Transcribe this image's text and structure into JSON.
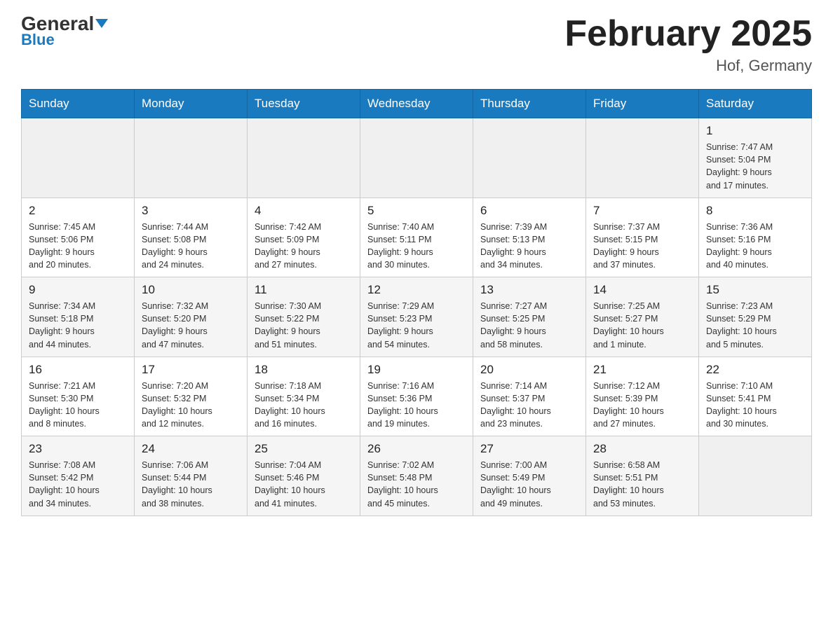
{
  "header": {
    "logo": {
      "general": "General",
      "blue": "Blue"
    },
    "title": "February 2025",
    "location": "Hof, Germany"
  },
  "weekdays": [
    "Sunday",
    "Monday",
    "Tuesday",
    "Wednesday",
    "Thursday",
    "Friday",
    "Saturday"
  ],
  "weeks": [
    {
      "days": [
        {
          "num": "",
          "info": ""
        },
        {
          "num": "",
          "info": ""
        },
        {
          "num": "",
          "info": ""
        },
        {
          "num": "",
          "info": ""
        },
        {
          "num": "",
          "info": ""
        },
        {
          "num": "",
          "info": ""
        },
        {
          "num": "1",
          "info": "Sunrise: 7:47 AM\nSunset: 5:04 PM\nDaylight: 9 hours\nand 17 minutes."
        }
      ]
    },
    {
      "days": [
        {
          "num": "2",
          "info": "Sunrise: 7:45 AM\nSunset: 5:06 PM\nDaylight: 9 hours\nand 20 minutes."
        },
        {
          "num": "3",
          "info": "Sunrise: 7:44 AM\nSunset: 5:08 PM\nDaylight: 9 hours\nand 24 minutes."
        },
        {
          "num": "4",
          "info": "Sunrise: 7:42 AM\nSunset: 5:09 PM\nDaylight: 9 hours\nand 27 minutes."
        },
        {
          "num": "5",
          "info": "Sunrise: 7:40 AM\nSunset: 5:11 PM\nDaylight: 9 hours\nand 30 minutes."
        },
        {
          "num": "6",
          "info": "Sunrise: 7:39 AM\nSunset: 5:13 PM\nDaylight: 9 hours\nand 34 minutes."
        },
        {
          "num": "7",
          "info": "Sunrise: 7:37 AM\nSunset: 5:15 PM\nDaylight: 9 hours\nand 37 minutes."
        },
        {
          "num": "8",
          "info": "Sunrise: 7:36 AM\nSunset: 5:16 PM\nDaylight: 9 hours\nand 40 minutes."
        }
      ]
    },
    {
      "days": [
        {
          "num": "9",
          "info": "Sunrise: 7:34 AM\nSunset: 5:18 PM\nDaylight: 9 hours\nand 44 minutes."
        },
        {
          "num": "10",
          "info": "Sunrise: 7:32 AM\nSunset: 5:20 PM\nDaylight: 9 hours\nand 47 minutes."
        },
        {
          "num": "11",
          "info": "Sunrise: 7:30 AM\nSunset: 5:22 PM\nDaylight: 9 hours\nand 51 minutes."
        },
        {
          "num": "12",
          "info": "Sunrise: 7:29 AM\nSunset: 5:23 PM\nDaylight: 9 hours\nand 54 minutes."
        },
        {
          "num": "13",
          "info": "Sunrise: 7:27 AM\nSunset: 5:25 PM\nDaylight: 9 hours\nand 58 minutes."
        },
        {
          "num": "14",
          "info": "Sunrise: 7:25 AM\nSunset: 5:27 PM\nDaylight: 10 hours\nand 1 minute."
        },
        {
          "num": "15",
          "info": "Sunrise: 7:23 AM\nSunset: 5:29 PM\nDaylight: 10 hours\nand 5 minutes."
        }
      ]
    },
    {
      "days": [
        {
          "num": "16",
          "info": "Sunrise: 7:21 AM\nSunset: 5:30 PM\nDaylight: 10 hours\nand 8 minutes."
        },
        {
          "num": "17",
          "info": "Sunrise: 7:20 AM\nSunset: 5:32 PM\nDaylight: 10 hours\nand 12 minutes."
        },
        {
          "num": "18",
          "info": "Sunrise: 7:18 AM\nSunset: 5:34 PM\nDaylight: 10 hours\nand 16 minutes."
        },
        {
          "num": "19",
          "info": "Sunrise: 7:16 AM\nSunset: 5:36 PM\nDaylight: 10 hours\nand 19 minutes."
        },
        {
          "num": "20",
          "info": "Sunrise: 7:14 AM\nSunset: 5:37 PM\nDaylight: 10 hours\nand 23 minutes."
        },
        {
          "num": "21",
          "info": "Sunrise: 7:12 AM\nSunset: 5:39 PM\nDaylight: 10 hours\nand 27 minutes."
        },
        {
          "num": "22",
          "info": "Sunrise: 7:10 AM\nSunset: 5:41 PM\nDaylight: 10 hours\nand 30 minutes."
        }
      ]
    },
    {
      "days": [
        {
          "num": "23",
          "info": "Sunrise: 7:08 AM\nSunset: 5:42 PM\nDaylight: 10 hours\nand 34 minutes."
        },
        {
          "num": "24",
          "info": "Sunrise: 7:06 AM\nSunset: 5:44 PM\nDaylight: 10 hours\nand 38 minutes."
        },
        {
          "num": "25",
          "info": "Sunrise: 7:04 AM\nSunset: 5:46 PM\nDaylight: 10 hours\nand 41 minutes."
        },
        {
          "num": "26",
          "info": "Sunrise: 7:02 AM\nSunset: 5:48 PM\nDaylight: 10 hours\nand 45 minutes."
        },
        {
          "num": "27",
          "info": "Sunrise: 7:00 AM\nSunset: 5:49 PM\nDaylight: 10 hours\nand 49 minutes."
        },
        {
          "num": "28",
          "info": "Sunrise: 6:58 AM\nSunset: 5:51 PM\nDaylight: 10 hours\nand 53 minutes."
        },
        {
          "num": "",
          "info": ""
        }
      ]
    }
  ]
}
